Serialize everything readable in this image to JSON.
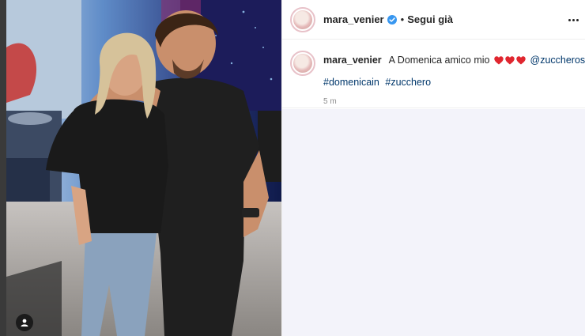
{
  "post": {
    "username": "mara_venier",
    "follow_status": "Segui già",
    "separator": "•",
    "caption_text": "A Domenica amico mio",
    "mention": "@zuccherosugar",
    "hashtags": [
      "#domenicain",
      "#zucchero"
    ],
    "timestamp": "5 m",
    "heart_count": 3
  },
  "icons": {
    "verified": "verified-badge-icon",
    "more": "more-options-icon",
    "tag": "user-tag-icon",
    "heart": "red-heart-icon"
  },
  "colors": {
    "verified_blue": "#3897f0",
    "heart_red": "#e0262f",
    "link_blue": "#00376b"
  }
}
